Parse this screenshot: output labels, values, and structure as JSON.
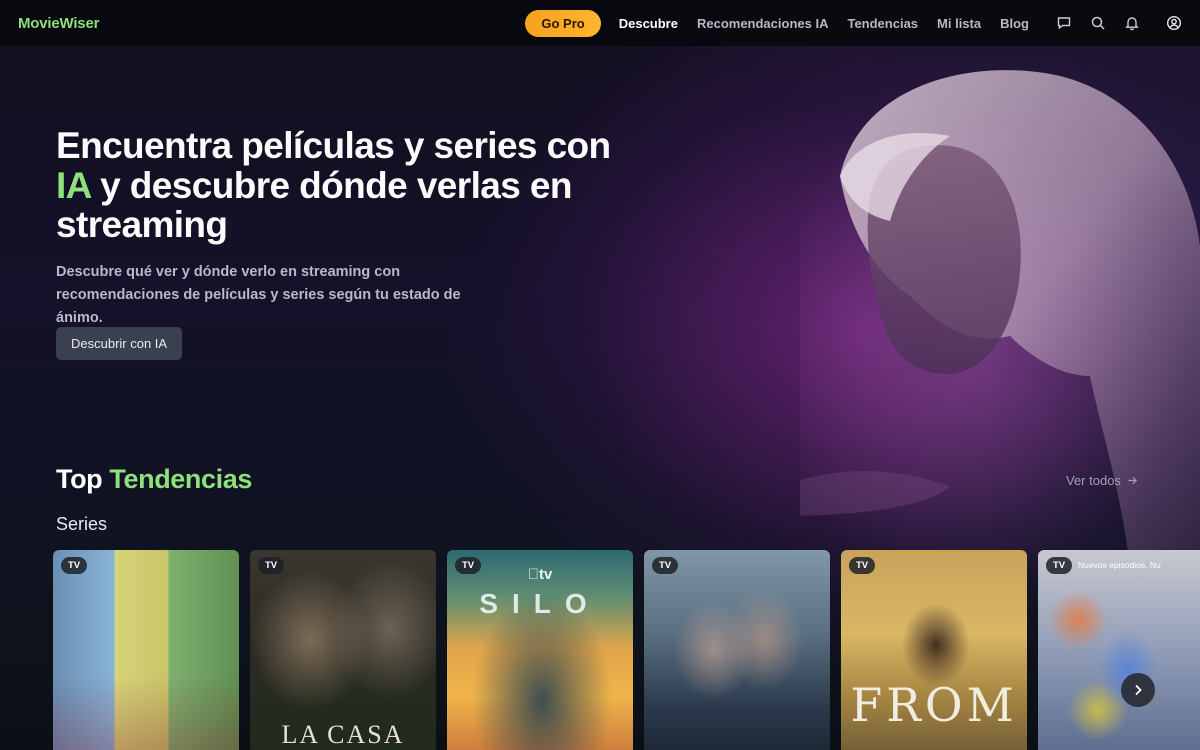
{
  "brand": {
    "name": "MovieWiser",
    "accent": "#8ee07a"
  },
  "nav": {
    "pro_label": "Go Pro",
    "links": [
      "Descubre",
      "Recomendaciones IA",
      "Tendencias",
      "Mi lista",
      "Blog"
    ],
    "active": "Descubre",
    "icons": [
      "chat-icon",
      "search-icon",
      "bell-icon",
      "user-icon"
    ]
  },
  "hero": {
    "title_part1": "Encuentra películas y series con ",
    "title_accent": "IA",
    "title_part2": " y descubre dónde verlas en streaming",
    "subtitle": "Descubre qué ver y dónde verlo en streaming con recomendaciones de películas y series según tu estado de ánimo.",
    "cta_label": "Descubrir con IA"
  },
  "trending": {
    "title_part1": "Top ",
    "title_accent": "Tendencias",
    "see_all": "Ver todos",
    "category": "Series",
    "cards": [
      {
        "badge": "TV",
        "poster_text": ""
      },
      {
        "badge": "TV",
        "poster_text": "LA CASA DEL"
      },
      {
        "badge": "TV",
        "poster_text": "SILO",
        "brand_text": "tv"
      },
      {
        "badge": "TV",
        "poster_text": ""
      },
      {
        "badge": "TV",
        "poster_text": "FROM"
      },
      {
        "badge": "TV",
        "poster_text": "",
        "extra": "Nuevos episodios. Nu"
      }
    ]
  }
}
